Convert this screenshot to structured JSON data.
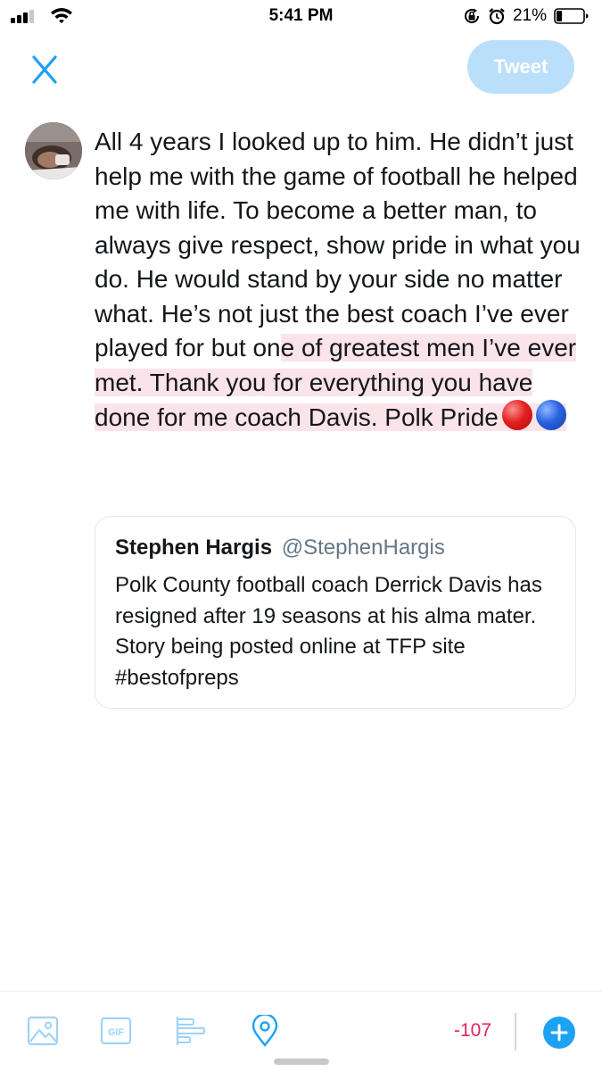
{
  "status_bar": {
    "time": "5:41 PM",
    "battery_percent": "21%",
    "battery_level": 0.21
  },
  "header": {
    "tweet_label": "Tweet"
  },
  "composer": {
    "text_plain": "All 4 years I looked up to him. He didn’t just help me with the game of football he helped me with life. To become a better man, to always give respect, show pride in what you do. He would stand by your side no matter what. He’s not just the best coach I’ve ever played for but on",
    "text_over_limit": "e of greatest men I’ve ever met. Thank you for everything you have done for me coach Davis. Polk Pride",
    "emojis": [
      "red-circle",
      "blue-circle"
    ]
  },
  "quoted_tweet": {
    "name": "Stephen Hargis",
    "handle": "@StephenHargis",
    "text": "Polk County football coach Derrick Davis has resigned after 19 seasons at his alma mater. Story being posted online at TFP site #bestofpreps"
  },
  "toolbar": {
    "char_count": "-107",
    "icons": [
      "image-icon",
      "gif-icon",
      "poll-icon",
      "location-icon",
      "add-tweet-icon"
    ]
  },
  "colors": {
    "accent": "#1da1f2",
    "tweet_button_disabled": "#b9dffb",
    "over_limit_highlight": "#fbe3ea",
    "over_limit_count": "#e0245e"
  }
}
